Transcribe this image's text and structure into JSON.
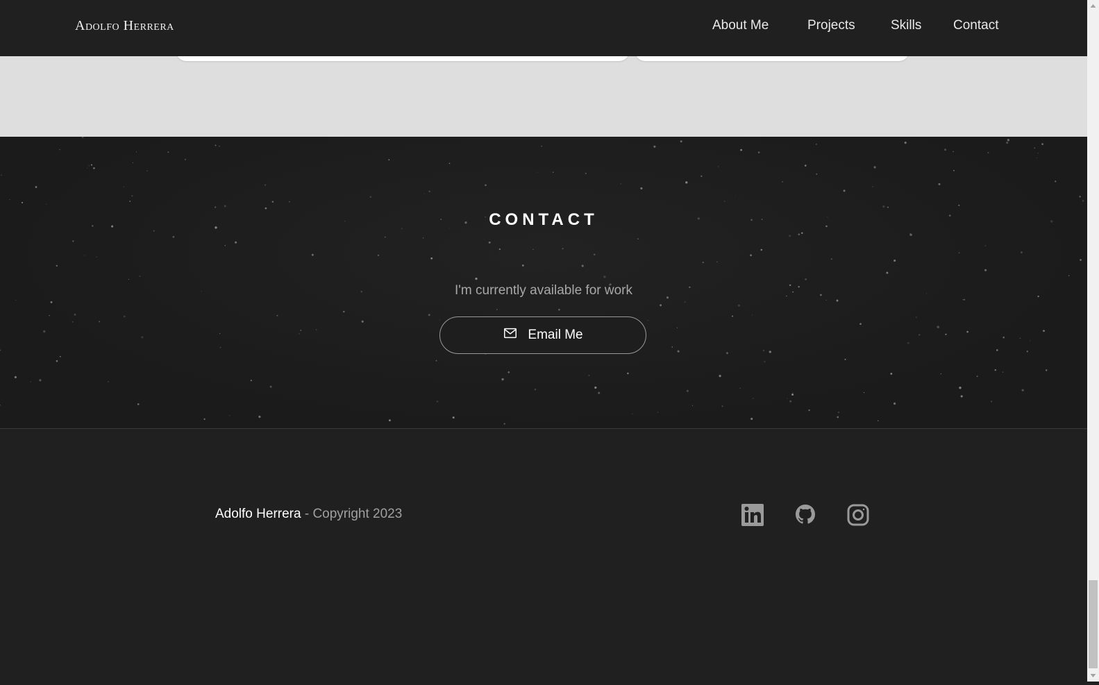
{
  "header": {
    "brand": "Adolfo Herrera",
    "nav": [
      {
        "label": "About Me",
        "name": "nav-about-me"
      },
      {
        "label": "Projects",
        "name": "nav-projects"
      },
      {
        "label": "Skills",
        "name": "nav-skills"
      },
      {
        "label": "Contact",
        "name": "nav-contact"
      }
    ]
  },
  "contact": {
    "title": "CONTACT",
    "subtitle": "I'm currently available for work",
    "email_button": {
      "label": "Email Me",
      "icon": "mail-icon"
    }
  },
  "footer": {
    "name": "Adolfo Herrera",
    "copyright": " - Copyright 2023",
    "socials": [
      {
        "icon": "linkedin-icon"
      },
      {
        "icon": "github-icon"
      },
      {
        "icon": "instagram-icon"
      }
    ]
  },
  "colors": {
    "header_bg": "#202020",
    "contact_bg": "#1c1b1c",
    "light_section_bg": "#dedede",
    "muted_text": "#a8a8a8",
    "social_icon": "#9a9a9a"
  }
}
